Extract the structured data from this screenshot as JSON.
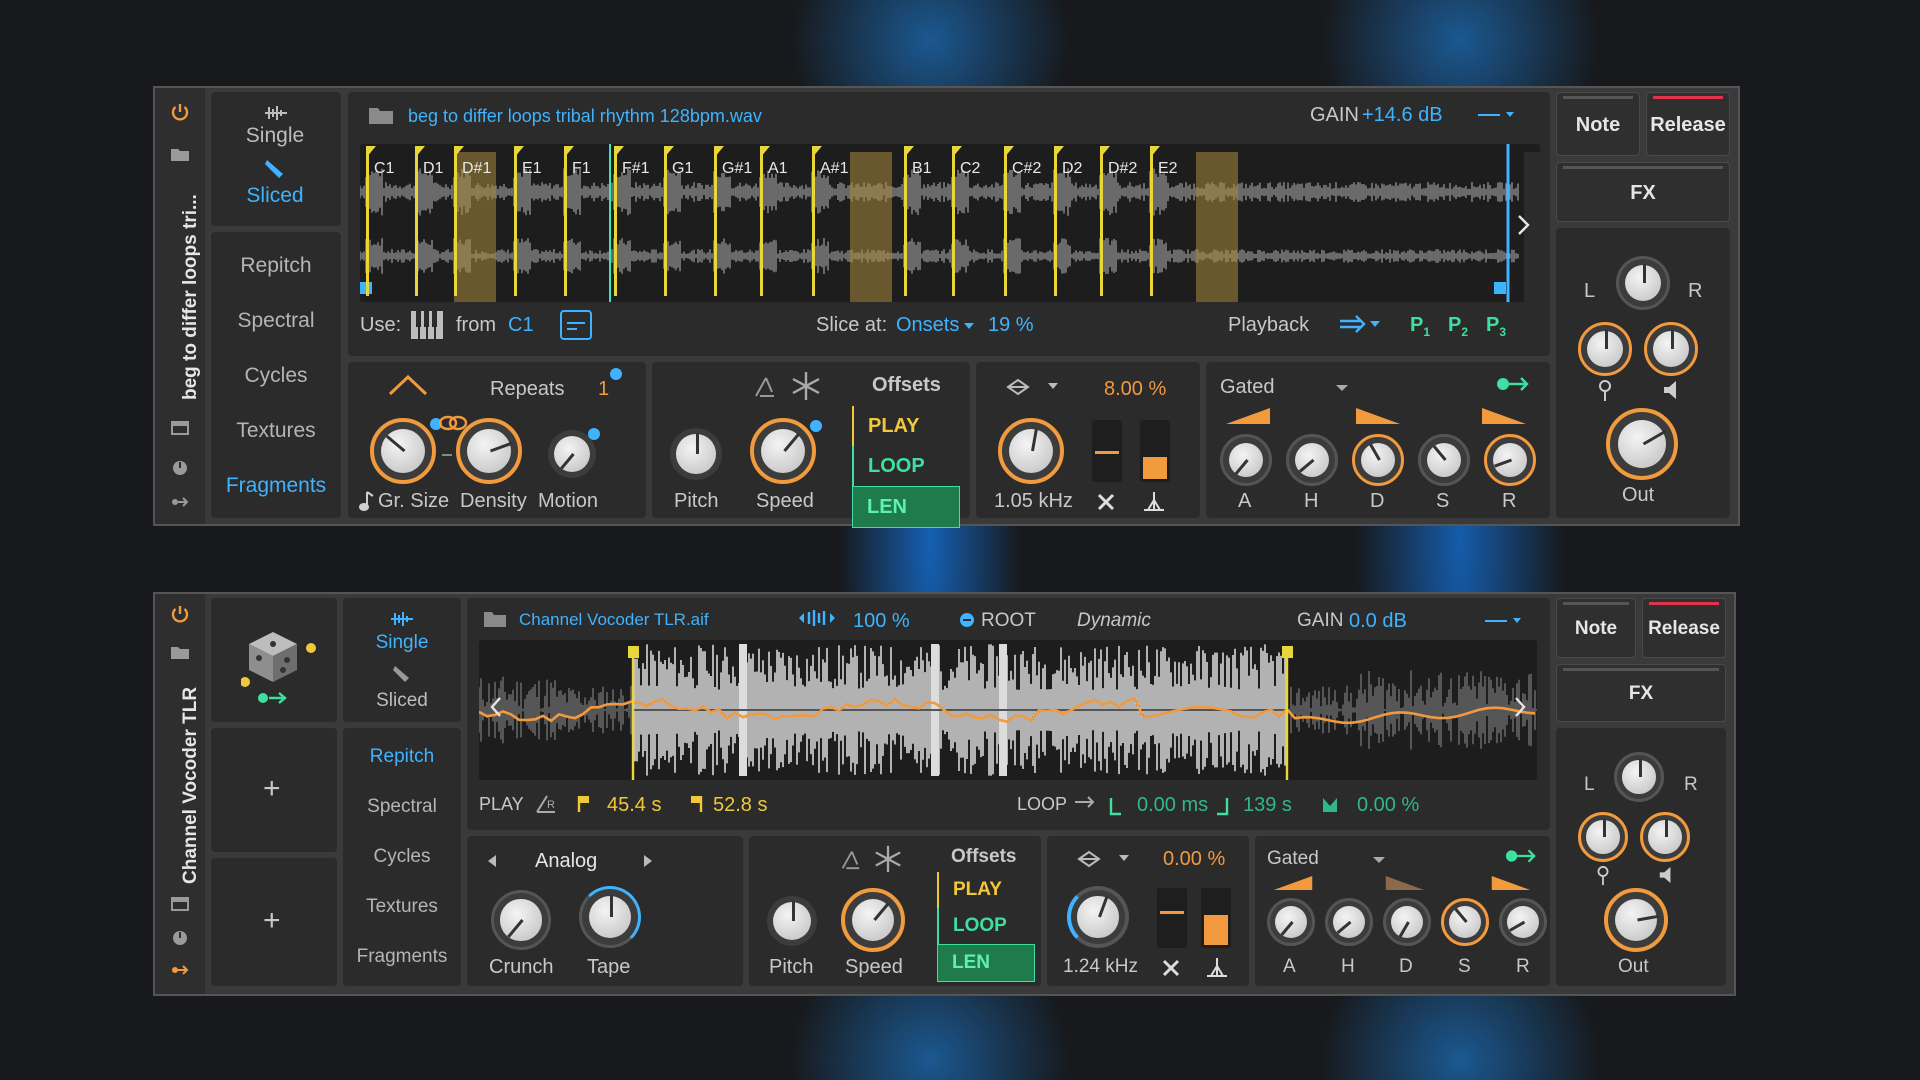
{
  "device1": {
    "title": "beg to differ loops tri...",
    "modes": {
      "single": "Single",
      "sliced": "Sliced"
    },
    "tabs": [
      "Repitch",
      "Spectral",
      "Cycles",
      "Textures",
      "Fragments"
    ],
    "active_tab": "Fragments",
    "file": "beg to differ loops tribal rhythm 128bpm.wav",
    "gain_label": "GAIN",
    "gain_value": "+14.6 dB",
    "slices": [
      "C1",
      "D1",
      "D#1",
      "E1",
      "F1",
      "F#1",
      "G1",
      "G#1",
      "A1",
      "A#1",
      "B1",
      "C2",
      "C#2",
      "D2",
      "D#2",
      "E2"
    ],
    "use_label": "Use:",
    "from_label": "from",
    "from_value": "C1",
    "slice_at_label": "Slice at:",
    "slice_at_value": "Onsets",
    "slice_pct": "19 %",
    "playback_label": "Playback",
    "p_buttons": [
      "P",
      "P",
      "P"
    ],
    "p_subs": [
      "1",
      "2",
      "3"
    ],
    "repeats_label": "Repeats",
    "repeats_value": "1",
    "knobs": {
      "gr_size": "Gr. Size",
      "density": "Density",
      "motion": "Motion"
    },
    "pitch": "Pitch",
    "speed": "Speed",
    "offsets": "Offsets",
    "play": "PLAY",
    "loop": "LOOP",
    "len": "LEN",
    "filter_pct": "8.00 %",
    "filter_freq": "1.05 kHz",
    "env_mode": "Gated",
    "adsr": [
      "A",
      "H",
      "D",
      "S",
      "R"
    ],
    "note": "Note",
    "release": "Release",
    "fx": "FX",
    "l": "L",
    "r": "R",
    "out": "Out"
  },
  "device2": {
    "title": "Channel Vocoder TLR",
    "modes": {
      "single": "Single",
      "sliced": "Sliced"
    },
    "tabs": [
      "Repitch",
      "Spectral",
      "Cycles",
      "Textures",
      "Fragments"
    ],
    "active_tab": "Repitch",
    "file": "Channel Vocoder TLR.aif",
    "speed_pct": "100 %",
    "root": "ROOT",
    "dynamic": "Dynamic",
    "gain_label": "GAIN",
    "gain_value": "0.0 dB",
    "play_label": "PLAY",
    "play_start": "45.4 s",
    "play_end": "52.8 s",
    "loop_label": "LOOP",
    "loop_ms": "0.00 ms",
    "loop_s": "139 s",
    "loop_pct": "0.00 %",
    "nav_label": "Analog",
    "crunch": "Crunch",
    "tape": "Tape",
    "pitch": "Pitch",
    "speed": "Speed",
    "offsets": "Offsets",
    "play": "PLAY",
    "loop": "LOOP",
    "len": "LEN",
    "filter_pct": "0.00 %",
    "filter_freq": "1.24 kHz",
    "env_mode": "Gated",
    "adsr": [
      "A",
      "H",
      "D",
      "S",
      "R"
    ],
    "note": "Note",
    "release": "Release",
    "fx": "FX",
    "l": "L",
    "r": "R",
    "out": "Out",
    "plus": "+"
  },
  "colors": {
    "accent": "#3fb3ff",
    "orange": "#f19a3e",
    "yellow": "#f0c838",
    "green": "#3ee0a0",
    "red": "#e0334a"
  }
}
